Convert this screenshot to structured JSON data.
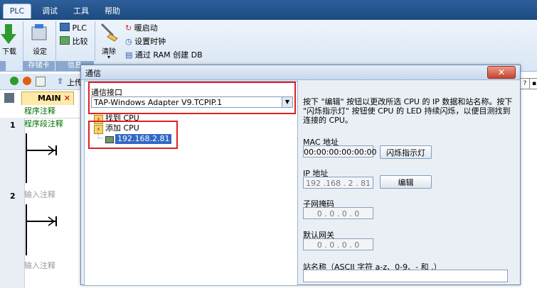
{
  "ribbon": {
    "tabs": [
      "PLC",
      "调试",
      "工具",
      "帮助"
    ],
    "download_label": "下载",
    "settings_label": "设定",
    "memory_card_group": "存储卡",
    "info_group": "信息",
    "plc_label": "PLC",
    "compare_label": "比较",
    "clear_label": "清除",
    "warm_start_label": "暖启动",
    "set_clock_label": "设置时钟",
    "create_db_label": "通过 RAM 创建 DB"
  },
  "editor": {
    "toolbar_hint": "上传",
    "tab_label": "MAIN",
    "program_comment": "程序注释",
    "rung1_num": "1",
    "rung1_comment": "程序段注释",
    "rung2_num": "2",
    "rung2_comment": "输入注释",
    "rung3_comment": "输入注释"
  },
  "dialog": {
    "title": "通信",
    "close_glyph": "✕",
    "interface_label": "通信接口",
    "interface_value": "TAP-Windows Adapter V9.TCPIP.1",
    "tree": {
      "find_cpu": "找到 CPU",
      "add_cpu": "添加 CPU",
      "ip_item": "192.168.2.81"
    },
    "hint": "按下 \"编辑\" 按钮以更改所选 CPU 的 IP 数据和站名称。按下 \"闪烁指示灯\" 按钮使 CPU 的 LED 持续闪烁，以便目测找到连接的 CPU。",
    "mac_label": "MAC 地址",
    "mac_value": "00:00:00:00:00:00",
    "blink_button": "闪烁指示灯",
    "ip_label": "IP 地址",
    "ip_value": "192 .168 . 2 . 81",
    "edit_button": "编辑",
    "subnet_label": "子网掩码",
    "subnet_value": "0 . 0 . 0 . 0",
    "gateway_label": "默认网关",
    "gateway_value": "0 . 0 . 0 . 0",
    "station_label": "站名称（ASCII 字符 a-z、0-9、- 和 .）"
  }
}
